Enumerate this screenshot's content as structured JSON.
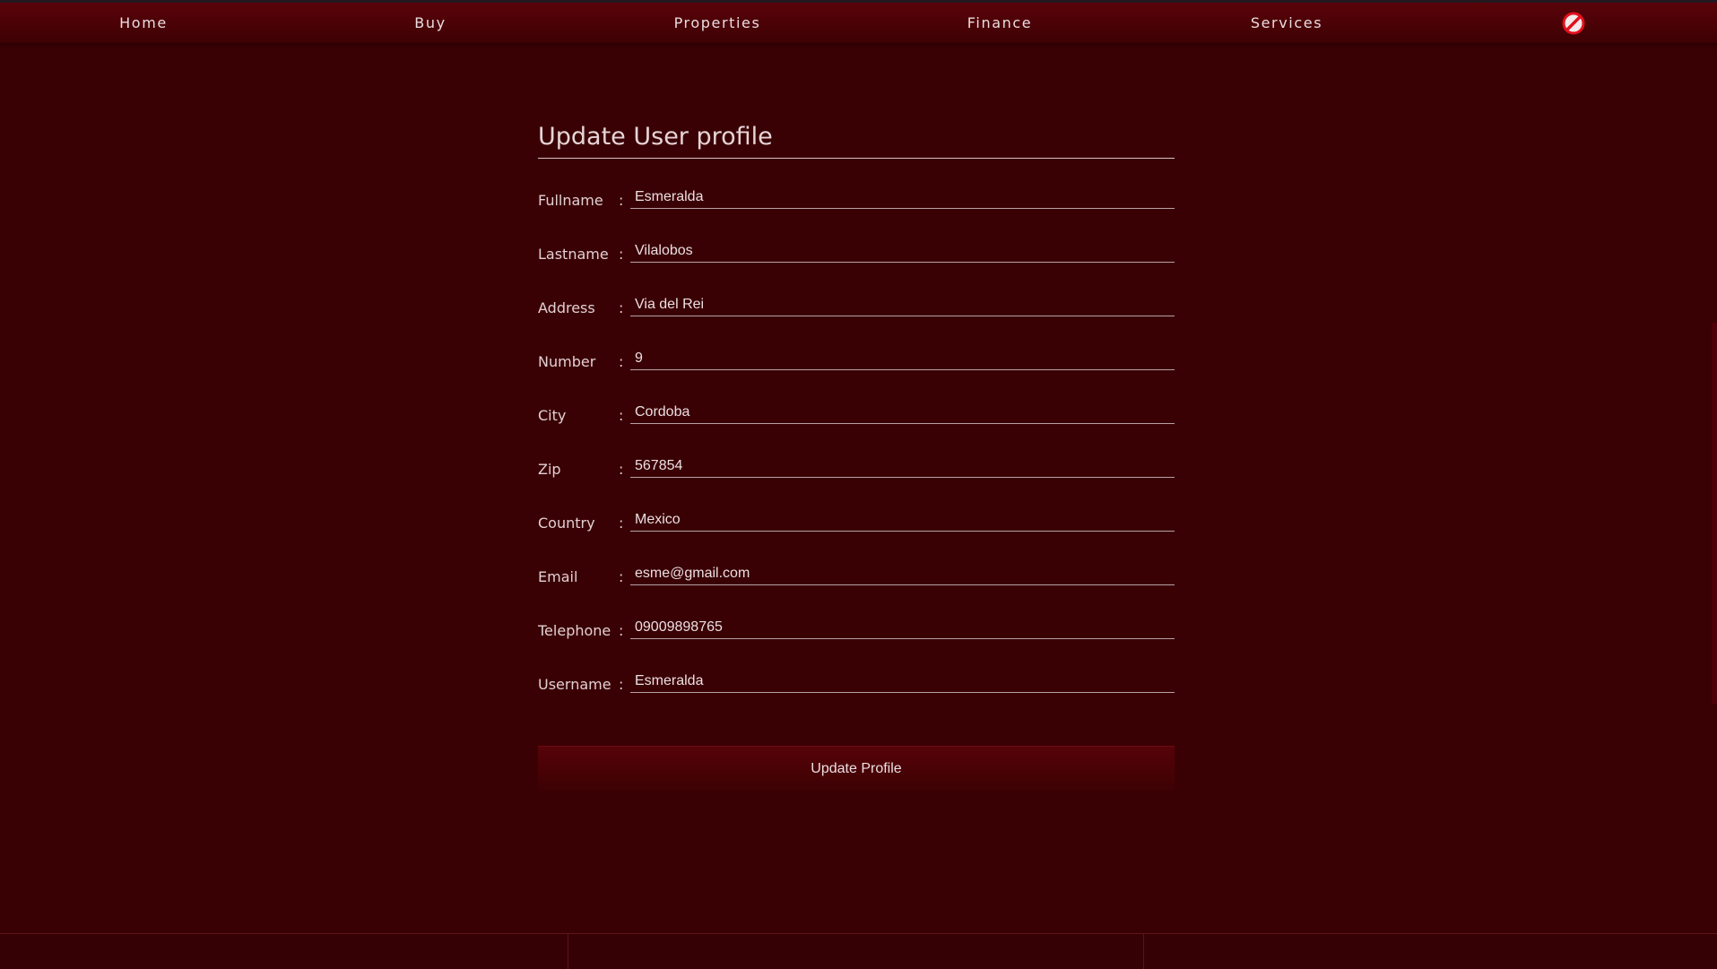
{
  "nav": {
    "items": [
      {
        "label": "Home"
      },
      {
        "label": "Buy"
      },
      {
        "label": "Properties"
      },
      {
        "label": "Finance"
      },
      {
        "label": "Services"
      }
    ],
    "logout_icon": "no-entry-icon",
    "accent_color": "#e0101e"
  },
  "form": {
    "title": "Update User profile",
    "colon": ":",
    "fields": [
      {
        "label": "Fullname",
        "value": "Esmeralda"
      },
      {
        "label": "Lastname",
        "value": "Vilalobos"
      },
      {
        "label": "Address",
        "value": "Via del Rei"
      },
      {
        "label": "Number",
        "value": "9"
      },
      {
        "label": "City",
        "value": "Cordoba"
      },
      {
        "label": "Zip",
        "value": "567854"
      },
      {
        "label": "Country",
        "value": "Mexico"
      },
      {
        "label": "Email",
        "value": "esme@gmail.com"
      },
      {
        "label": "Telephone",
        "value": "09009898765"
      },
      {
        "label": "Username",
        "value": "Esmeralda"
      }
    ],
    "submit_label": "Update Profile"
  },
  "colors": {
    "background": "#3a0104",
    "nav_background": "#5a0309",
    "text": "#e6d6d8"
  }
}
